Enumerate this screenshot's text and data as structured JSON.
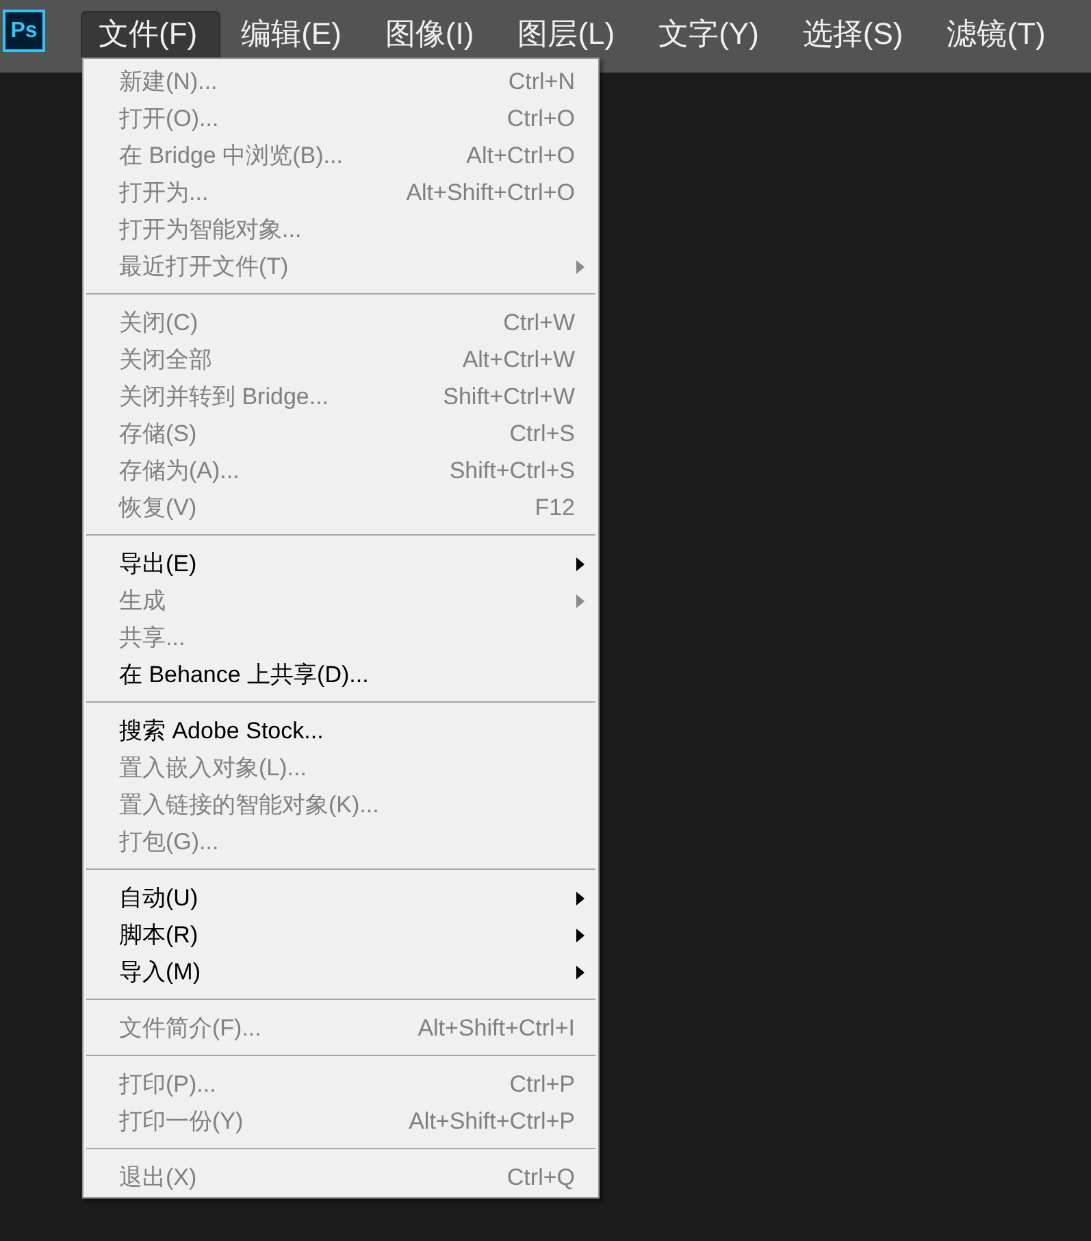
{
  "logo": {
    "text": "Ps"
  },
  "menubar": [
    {
      "label": "文件(F)",
      "selected": true
    },
    {
      "label": "编辑(E)",
      "selected": false
    },
    {
      "label": "图像(I)",
      "selected": false
    },
    {
      "label": "图层(L)",
      "selected": false
    },
    {
      "label": "文字(Y)",
      "selected": false
    },
    {
      "label": "选择(S)",
      "selected": false
    },
    {
      "label": "滤镜(T)",
      "selected": false
    }
  ],
  "menu": {
    "groups": [
      {
        "items": [
          {
            "label": "新建(N)...",
            "shortcut": "Ctrl+N",
            "disabled": true,
            "submenu": false
          },
          {
            "label": "打开(O)...",
            "shortcut": "Ctrl+O",
            "disabled": true,
            "submenu": false
          },
          {
            "label": "在 Bridge 中浏览(B)...",
            "shortcut": "Alt+Ctrl+O",
            "disabled": true,
            "submenu": false
          },
          {
            "label": "打开为...",
            "shortcut": "Alt+Shift+Ctrl+O",
            "disabled": true,
            "submenu": false
          },
          {
            "label": "打开为智能对象...",
            "disabled": true,
            "submenu": false
          },
          {
            "label": "最近打开文件(T)",
            "disabled": true,
            "submenu": true
          }
        ]
      },
      {
        "items": [
          {
            "label": "关闭(C)",
            "shortcut": "Ctrl+W",
            "disabled": true,
            "submenu": false
          },
          {
            "label": "关闭全部",
            "shortcut": "Alt+Ctrl+W",
            "disabled": true,
            "submenu": false
          },
          {
            "label": "关闭并转到 Bridge...",
            "shortcut": "Shift+Ctrl+W",
            "disabled": true,
            "submenu": false
          },
          {
            "label": "存储(S)",
            "shortcut": "Ctrl+S",
            "disabled": true,
            "submenu": false
          },
          {
            "label": "存储为(A)...",
            "shortcut": "Shift+Ctrl+S",
            "disabled": true,
            "submenu": false
          },
          {
            "label": "恢复(V)",
            "shortcut": "F12",
            "disabled": true,
            "submenu": false
          }
        ]
      },
      {
        "items": [
          {
            "label": "导出(E)",
            "disabled": false,
            "submenu": true
          },
          {
            "label": "生成",
            "disabled": true,
            "submenu": true
          },
          {
            "label": "共享...",
            "disabled": true,
            "submenu": false
          },
          {
            "label": "在 Behance 上共享(D)...",
            "disabled": false,
            "submenu": false
          }
        ]
      },
      {
        "items": [
          {
            "label": "搜索 Adobe Stock...",
            "disabled": false,
            "submenu": false
          },
          {
            "label": "置入嵌入对象(L)...",
            "disabled": true,
            "submenu": false
          },
          {
            "label": "置入链接的智能对象(K)...",
            "disabled": true,
            "submenu": false
          },
          {
            "label": "打包(G)...",
            "disabled": true,
            "submenu": false
          }
        ]
      },
      {
        "items": [
          {
            "label": "自动(U)",
            "disabled": false,
            "submenu": true
          },
          {
            "label": "脚本(R)",
            "disabled": false,
            "submenu": true
          },
          {
            "label": "导入(M)",
            "disabled": false,
            "submenu": true
          }
        ]
      },
      {
        "items": [
          {
            "label": "文件简介(F)...",
            "shortcut": "Alt+Shift+Ctrl+I",
            "disabled": true,
            "submenu": false
          }
        ]
      },
      {
        "items": [
          {
            "label": "打印(P)...",
            "shortcut": "Ctrl+P",
            "disabled": true,
            "submenu": false
          },
          {
            "label": "打印一份(Y)",
            "shortcut": "Alt+Shift+Ctrl+P",
            "disabled": true,
            "submenu": false
          }
        ]
      },
      {
        "items": [
          {
            "label": "退出(X)",
            "shortcut": "Ctrl+Q",
            "disabled": true,
            "submenu": false
          }
        ]
      }
    ]
  }
}
